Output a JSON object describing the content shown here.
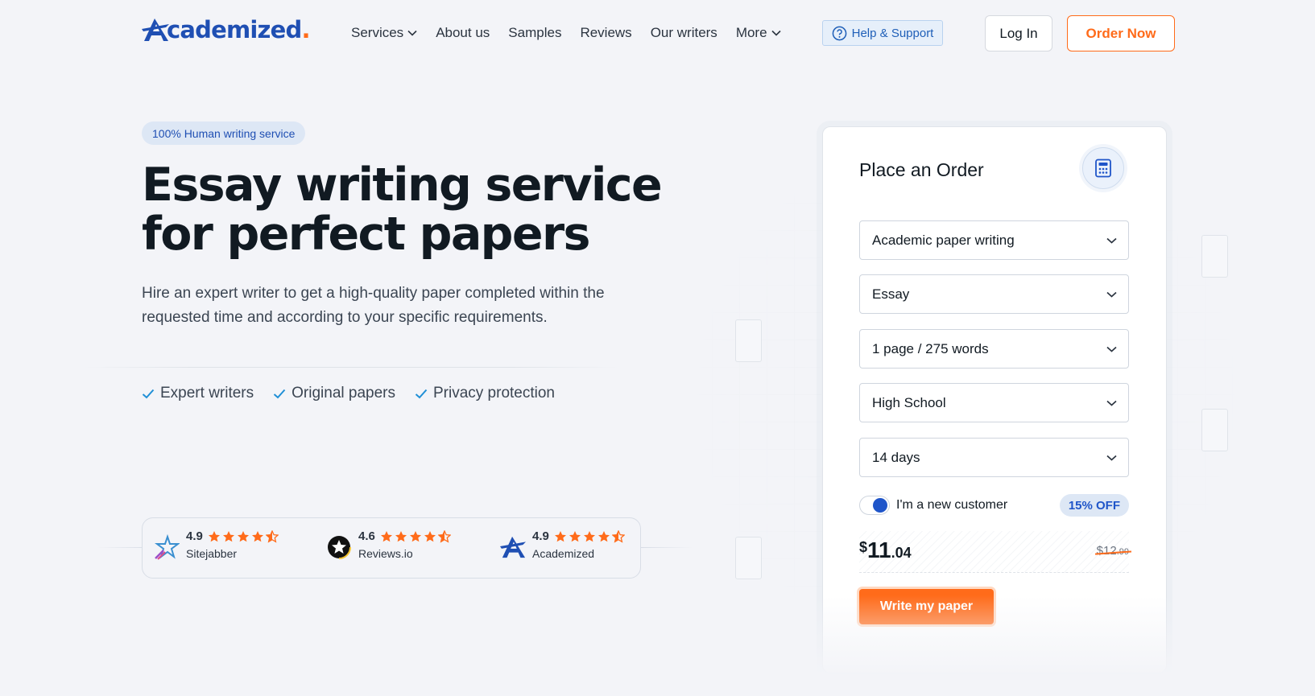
{
  "brand": {
    "name": "cademized",
    "dot": ".",
    "accent": "#ff6b1a",
    "primary": "#1f4fb3"
  },
  "nav": {
    "items": [
      {
        "label": "Services",
        "has_dropdown": true
      },
      {
        "label": "About us",
        "has_dropdown": false
      },
      {
        "label": "Samples",
        "has_dropdown": false
      },
      {
        "label": "Reviews",
        "has_dropdown": false
      },
      {
        "label": "Our writers",
        "has_dropdown": false
      },
      {
        "label": "More",
        "has_dropdown": true
      }
    ],
    "help_label": "Help & Support",
    "login_label": "Log In",
    "order_label": "Order Now"
  },
  "hero": {
    "badge": "100% Human writing service",
    "headline_line1": "Essay writing service",
    "headline_line2": "for perfect papers",
    "subtext": "Hire an expert writer to get a high-quality paper completed within the requested time and according to your specific requirements.",
    "features": [
      "Expert writers",
      "Original papers",
      "Privacy protection"
    ]
  },
  "ratings": [
    {
      "score": "4.9",
      "name": "Sitejabber",
      "stars": 4.5,
      "icon": "sitejabber-icon"
    },
    {
      "score": "4.6",
      "name": "Reviews.io",
      "stars": 4.5,
      "icon": "reviewsio-icon"
    },
    {
      "score": "4.9",
      "name": "Academized",
      "stars": 4.5,
      "icon": "academized-icon"
    }
  ],
  "order_form": {
    "title": "Place an Order",
    "calculator_icon": "calculator-icon",
    "service_type": "Academic paper writing",
    "paper_type": "Essay",
    "pages": "1 page / 275 words",
    "level": "High School",
    "deadline": "14 days",
    "new_customer_label": "I'm a new customer",
    "new_customer_on": true,
    "discount_label": "15% OFF",
    "price_currency": "$",
    "price_int": "11",
    "price_dec": ".04",
    "old_price_currency": "$",
    "old_price_int": "12",
    "old_price_dec": ".99",
    "submit_label": "Write my paper"
  }
}
